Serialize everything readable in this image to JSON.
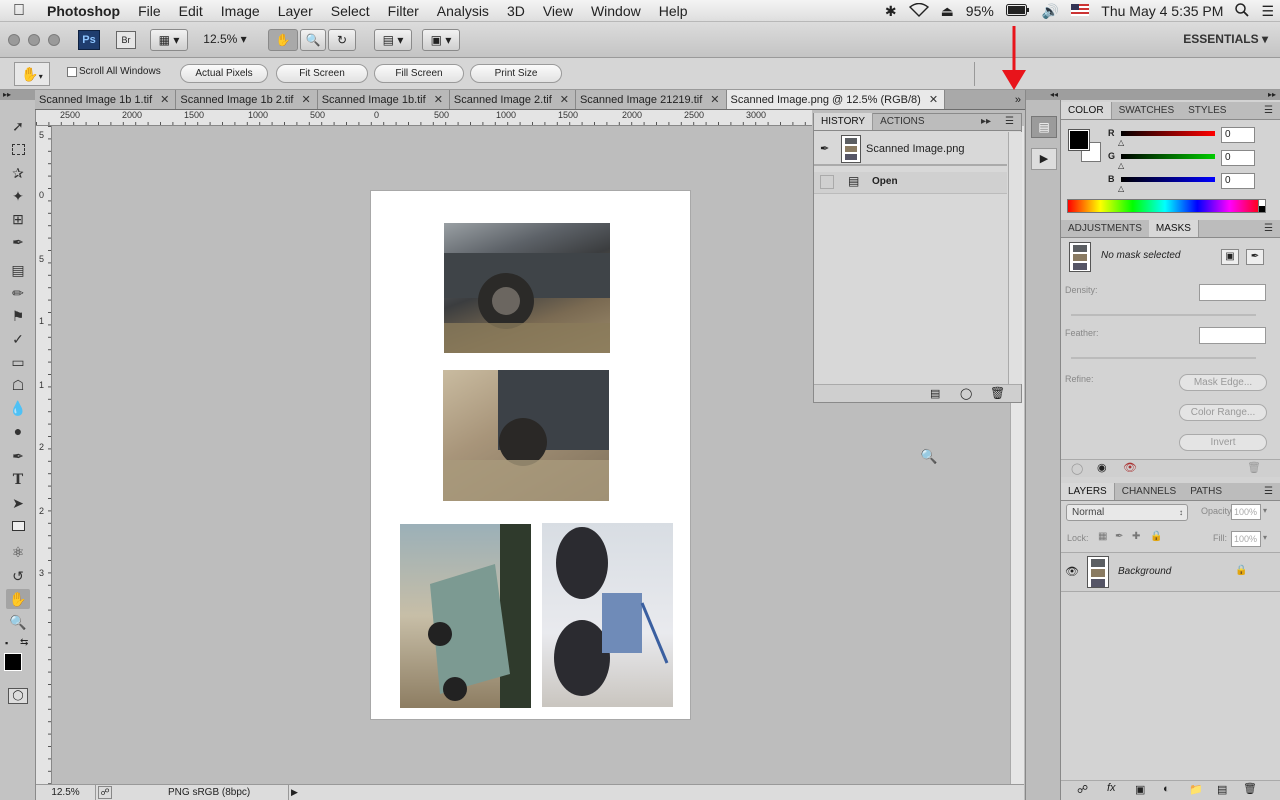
{
  "menubar": {
    "app": "Photoshop",
    "items": [
      "File",
      "Edit",
      "Image",
      "Layer",
      "Select",
      "Filter",
      "Analysis",
      "3D",
      "View",
      "Window",
      "Help"
    ],
    "battery": "95%",
    "clock": "Thu May 4  5:35 PM"
  },
  "appbar": {
    "ps_label": "Ps",
    "br_label": "Br",
    "zoom": "12.5%",
    "workspace": "ESSENTIALS"
  },
  "options": {
    "scroll_all": "Scroll All Windows",
    "actual_pixels": "Actual Pixels",
    "fit_screen": "Fit Screen",
    "fill_screen": "Fill Screen",
    "print_size": "Print Size"
  },
  "tabs": [
    {
      "label": "Scanned Image 1b 1.tif"
    },
    {
      "label": "Scanned Image 1b 2.tif"
    },
    {
      "label": "Scanned Image 1b.tif"
    },
    {
      "label": "Scanned Image 2.tif"
    },
    {
      "label": "Scanned Image 21219.tif"
    },
    {
      "label": "Scanned Image.png @ 12.5% (RGB/8)"
    }
  ],
  "ruler": {
    "h": [
      "2500",
      "2000",
      "1500",
      "1000",
      "500",
      "0",
      "500",
      "1000",
      "1500",
      "2000",
      "2500",
      "3000"
    ],
    "v": [
      "5",
      "0",
      "5",
      "1",
      "1",
      "2",
      "2",
      "3"
    ]
  },
  "history": {
    "tab_history": "HISTORY",
    "tab_actions": "ACTIONS",
    "snapshot": "Scanned Image.png",
    "state": "Open"
  },
  "color": {
    "tab_color": "COLOR",
    "tab_swatches": "SWATCHES",
    "tab_styles": "STYLES",
    "r_label": "R",
    "g_label": "G",
    "b_label": "B",
    "r": "0",
    "g": "0",
    "b": "0"
  },
  "masks": {
    "tab_adjustments": "ADJUSTMENTS",
    "tab_masks": "MASKS",
    "status": "No mask selected",
    "density_label": "Density:",
    "feather_label": "Feather:",
    "refine_label": "Refine:",
    "mask_edge": "Mask Edge...",
    "color_range": "Color Range...",
    "invert": "Invert"
  },
  "layers": {
    "tab_layers": "LAYERS",
    "tab_channels": "CHANNELS",
    "tab_paths": "PATHS",
    "blend_mode": "Normal",
    "opacity_label": "Opacity:",
    "opacity": "100%",
    "lock_label": "Lock:",
    "fill_label": "Fill:",
    "fill": "100%",
    "layer_name": "Background"
  },
  "status": {
    "zoom": "12.5%",
    "profile": "PNG sRGB (8bpc)"
  },
  "colors": {
    "accent_arrow": "#e8141b",
    "active_tab": "#e9e9e9"
  }
}
